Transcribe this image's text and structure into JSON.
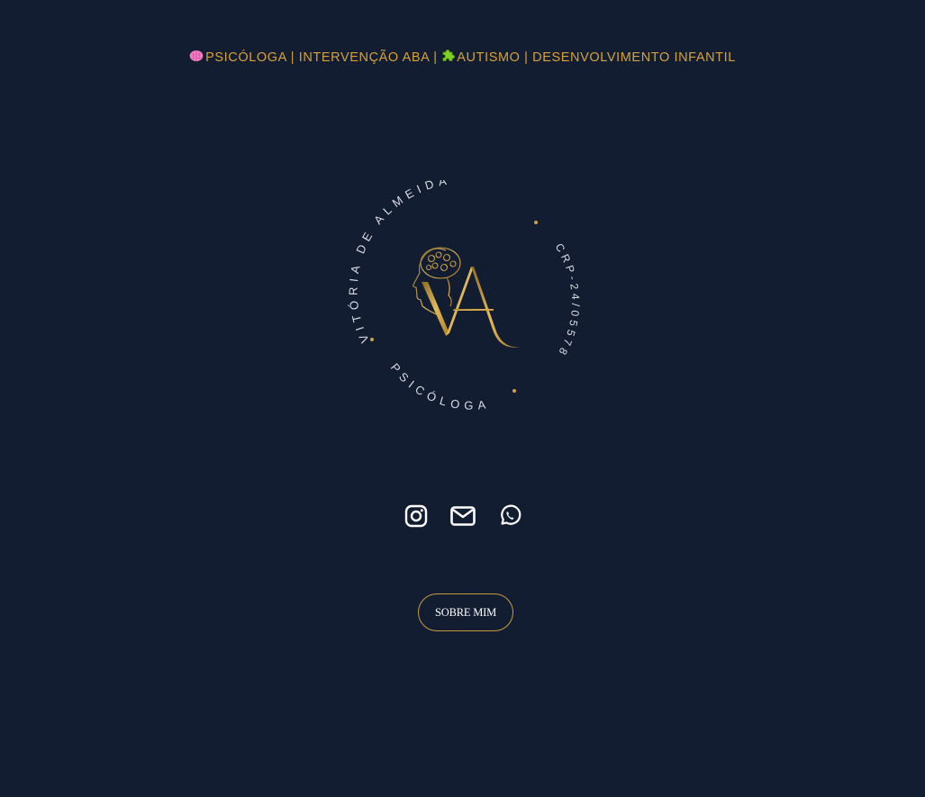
{
  "header": {
    "segments": [
      {
        "icon": "brain-icon",
        "text": "PSICÓLOGA | INTERVENÇÃO ABA | "
      },
      {
        "icon": "puzzle-piece-icon",
        "text": "AUTISMO | DESENVOLVIMENTO INFANTIL"
      }
    ]
  },
  "logo": {
    "name_arc": "VITÓRIA DE ALMEIDA",
    "crp_arc": "CRP-24/05578",
    "role_arc": "PSICÓLOGA",
    "monogram": "VA"
  },
  "socials": [
    {
      "icon": "instagram-icon"
    },
    {
      "icon": "envelope-icon"
    },
    {
      "icon": "whatsapp-icon"
    }
  ],
  "cta": {
    "about_label": "SOBRE MIM"
  },
  "colors": {
    "background": "#131d32",
    "gold": "#d4a238",
    "arc_text": "#d9dbe2",
    "icon": "#ffffff"
  }
}
